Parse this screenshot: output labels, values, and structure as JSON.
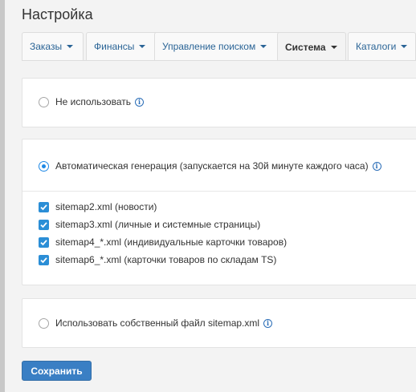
{
  "page": {
    "title": "Настройка"
  },
  "tabs": [
    {
      "label": "Заказы",
      "active": false
    },
    {
      "label": "Финансы",
      "active": false
    },
    {
      "label": "Управление поиском",
      "active": false
    },
    {
      "label": "Система",
      "active": true
    },
    {
      "label": "Каталоги",
      "active": false
    }
  ],
  "options": {
    "none": {
      "label": "Не использовать",
      "selected": false
    },
    "auto": {
      "label": "Автоматическая генерация (запускается на 30й минуте каждого часа)",
      "selected": true
    },
    "custom": {
      "label": "Использовать собственный файл sitemap.xml",
      "selected": false
    }
  },
  "sitemaps": [
    {
      "label": "sitemap2.xml (новости)",
      "checked": true
    },
    {
      "label": "sitemap3.xml (личные и системные страницы)",
      "checked": true
    },
    {
      "label": "sitemap4_*.xml (индивидуальные карточки товаров)",
      "checked": true
    },
    {
      "label": "sitemap6_*.xml (карточки товаров по складам TS)",
      "checked": true
    }
  ],
  "actions": {
    "save_label": "Сохранить"
  },
  "icons": {
    "info": "info-circle-icon",
    "caret": "caret-down-icon",
    "check": "check-icon"
  },
  "colors": {
    "accent": "#1e88e5",
    "checkbox": "#2b8ed6",
    "button": "#3a7fc4",
    "link": "#2a6496"
  }
}
